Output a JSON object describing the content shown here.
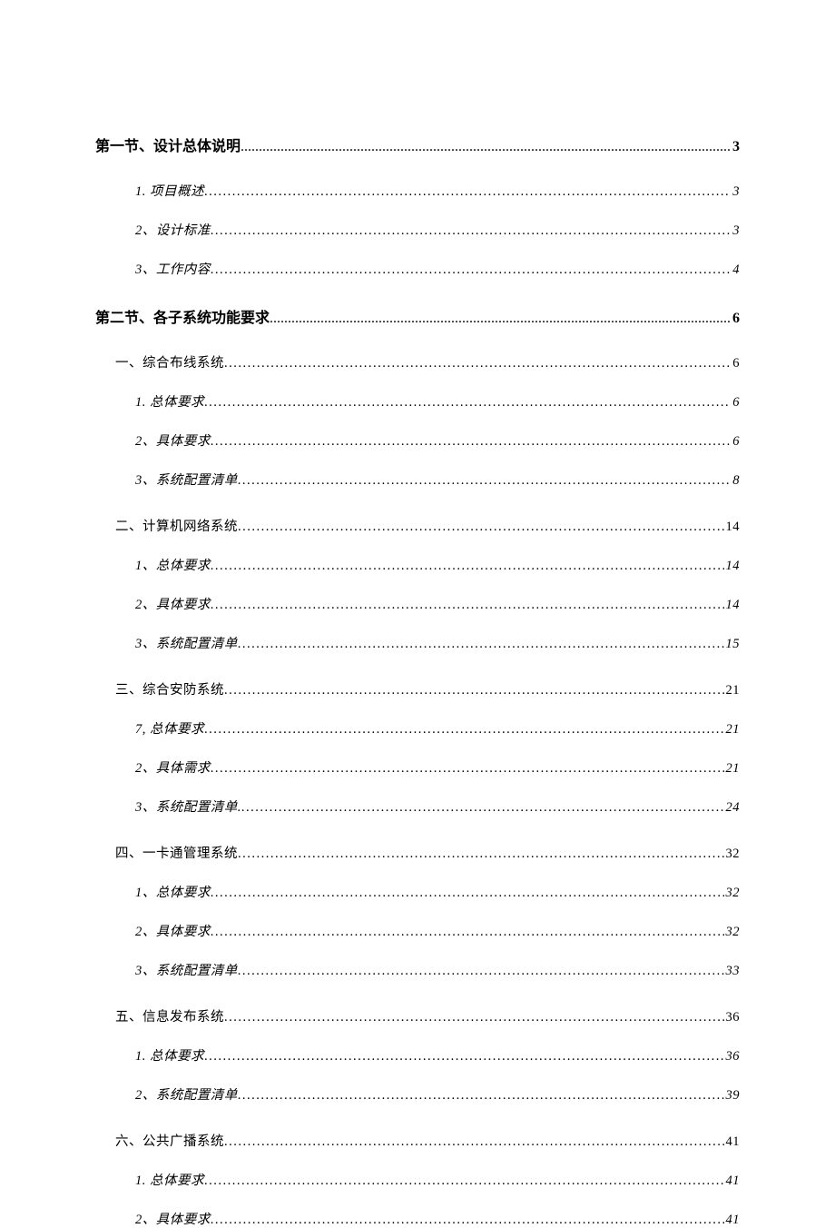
{
  "toc": [
    {
      "level": 1,
      "label": "第一节、设计总体说明",
      "page": "3"
    },
    {
      "level": 3,
      "label": "1. 项目概述",
      "page": "3"
    },
    {
      "level": 3,
      "label": "2、设计标准",
      "page": "3"
    },
    {
      "level": 3,
      "label": "3、工作内容",
      "page": "4",
      "groupEnd": true
    },
    {
      "level": 1,
      "label": "第二节、各子系统功能要求",
      "page": "6"
    },
    {
      "level": 2,
      "label": "一、综合布线系统",
      "page": "6"
    },
    {
      "level": 3,
      "label": "1. 总体要求",
      "page": "6"
    },
    {
      "level": 3,
      "label": "2、具体要求",
      "page": "6"
    },
    {
      "level": 3,
      "label": "3、系统配置清单",
      "page": "8",
      "groupEnd": true
    },
    {
      "level": 2,
      "label": "二、计算机网络系统",
      "page": "14"
    },
    {
      "level": 3,
      "label": "1、总体要求",
      "page": "14"
    },
    {
      "level": 3,
      "label": "2、具体要求",
      "page": "14"
    },
    {
      "level": 3,
      "label": "3、系统配置清单",
      "page": "15",
      "groupEnd": true
    },
    {
      "level": 2,
      "label": "三、综合安防系统",
      "page": "21"
    },
    {
      "level": 3,
      "label": "7, 总体要求",
      "page": "21"
    },
    {
      "level": 3,
      "label": "2、具体需求",
      "page": "21"
    },
    {
      "level": 3,
      "label": "3、系统配置清单.",
      "page": "24",
      "groupEnd": true
    },
    {
      "level": 2,
      "label": "四、一卡通管理系统",
      "page": "32"
    },
    {
      "level": 3,
      "label": "1、总体要求",
      "page": "32"
    },
    {
      "level": 3,
      "label": "2、具体要求",
      "page": "32"
    },
    {
      "level": 3,
      "label": "3、系统配置清单",
      "page": "33",
      "groupEnd": true
    },
    {
      "level": 2,
      "label": "五、信息发布系统",
      "page": "36"
    },
    {
      "level": 3,
      "label": "1. 总体要求",
      "page": "36"
    },
    {
      "level": 3,
      "label": "2、系统配置清单",
      "page": "39",
      "groupEnd": true
    },
    {
      "level": 2,
      "label": "六、公共广播系统",
      "page": "41"
    },
    {
      "level": 3,
      "label": "1. 总体要求",
      "page": "41"
    },
    {
      "level": 3,
      "label": "2、具体要求",
      "page": "41"
    }
  ]
}
